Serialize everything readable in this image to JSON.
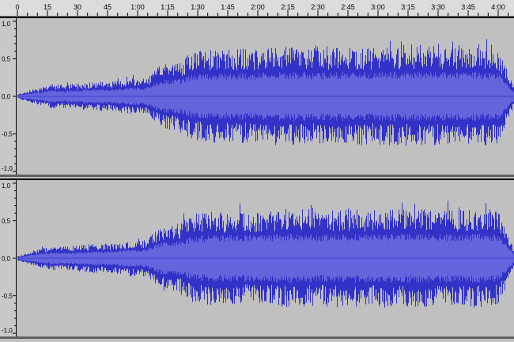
{
  "colors": {
    "background": "#c0c0c0",
    "ruler": "#dcdcdc",
    "waveform_outer": "#3232c8",
    "waveform_inner": "#6464dc",
    "center_line": "#4040d0",
    "vruler": "#c8c8c8"
  },
  "timeline": {
    "start_label": "0",
    "tick_labels": [
      "15",
      "30",
      "45",
      "1:00",
      "1:15",
      "1:30",
      "1:45",
      "2:00",
      "2:15",
      "2:30",
      "2:45",
      "3:00",
      "3:15",
      "3:30",
      "3:45",
      "4:00"
    ]
  },
  "channels": [
    {
      "name": "channel-top",
      "scale_labels": [
        "1,0",
        "0,5",
        "0,0",
        "-0,5",
        "-1,0"
      ],
      "envelope": [
        0.03,
        0.1,
        0.16,
        0.16,
        0.18,
        0.2,
        0.2,
        0.24,
        0.24,
        0.44,
        0.46,
        0.6,
        0.62,
        0.62,
        0.64,
        0.62,
        0.65,
        0.66,
        0.65,
        0.64,
        0.66,
        0.66,
        0.64,
        0.66,
        0.66,
        0.66,
        0.66,
        0.64,
        0.66,
        0.66,
        0.64,
        0.12
      ]
    },
    {
      "name": "channel-bottom",
      "scale_labels": [
        "1,0",
        "0,5",
        "0,0",
        "-0,5",
        "-1,0"
      ],
      "envelope": [
        0.03,
        0.1,
        0.16,
        0.16,
        0.18,
        0.2,
        0.2,
        0.24,
        0.24,
        0.44,
        0.46,
        0.6,
        0.62,
        0.62,
        0.64,
        0.62,
        0.65,
        0.66,
        0.65,
        0.64,
        0.66,
        0.66,
        0.64,
        0.66,
        0.66,
        0.66,
        0.66,
        0.64,
        0.66,
        0.66,
        0.64,
        0.12
      ]
    }
  ]
}
